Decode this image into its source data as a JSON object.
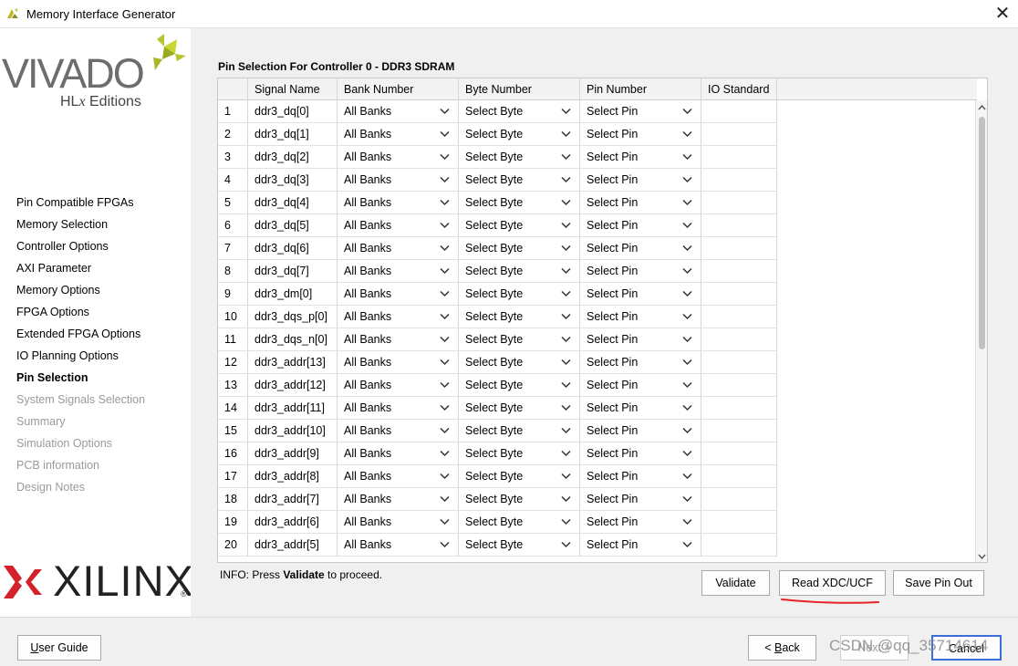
{
  "window": {
    "title": "Memory Interface Generator",
    "close_glyph": "✕"
  },
  "branding": {
    "vivado": "VIVADO",
    "hlx_prefix": "HL",
    "hlx_italic": "x",
    "hlx_suffix": " Editions",
    "xilinx": "XILINX",
    "xilinx_reg": "®"
  },
  "sidebar": {
    "items": [
      {
        "label": "Pin Compatible FPGAs",
        "state": "normal"
      },
      {
        "label": "Memory Selection",
        "state": "normal"
      },
      {
        "label": "Controller Options",
        "state": "normal"
      },
      {
        "label": "AXI Parameter",
        "state": "normal"
      },
      {
        "label": "Memory Options",
        "state": "normal"
      },
      {
        "label": "FPGA Options",
        "state": "normal"
      },
      {
        "label": "Extended FPGA Options",
        "state": "normal"
      },
      {
        "label": "IO Planning Options",
        "state": "normal"
      },
      {
        "label": "Pin Selection",
        "state": "active"
      },
      {
        "label": "System Signals Selection",
        "state": "disabled"
      },
      {
        "label": "Summary",
        "state": "disabled"
      },
      {
        "label": "Simulation Options",
        "state": "disabled"
      },
      {
        "label": "PCB information",
        "state": "disabled"
      },
      {
        "label": "Design Notes",
        "state": "disabled"
      }
    ]
  },
  "main": {
    "title": "Pin Selection For Controller 0 - DDR3 SDRAM",
    "columns": [
      "",
      "Signal Name",
      "Bank Number",
      "Byte Number",
      "Pin Number",
      "IO Standard"
    ],
    "rows": [
      {
        "num": "1",
        "signal": "ddr3_dq[0]",
        "bank": "All Banks",
        "byte": "Select Byte",
        "pin": "Select Pin",
        "io": ""
      },
      {
        "num": "2",
        "signal": "ddr3_dq[1]",
        "bank": "All Banks",
        "byte": "Select Byte",
        "pin": "Select Pin",
        "io": ""
      },
      {
        "num": "3",
        "signal": "ddr3_dq[2]",
        "bank": "All Banks",
        "byte": "Select Byte",
        "pin": "Select Pin",
        "io": ""
      },
      {
        "num": "4",
        "signal": "ddr3_dq[3]",
        "bank": "All Banks",
        "byte": "Select Byte",
        "pin": "Select Pin",
        "io": ""
      },
      {
        "num": "5",
        "signal": "ddr3_dq[4]",
        "bank": "All Banks",
        "byte": "Select Byte",
        "pin": "Select Pin",
        "io": ""
      },
      {
        "num": "6",
        "signal": "ddr3_dq[5]",
        "bank": "All Banks",
        "byte": "Select Byte",
        "pin": "Select Pin",
        "io": ""
      },
      {
        "num": "7",
        "signal": "ddr3_dq[6]",
        "bank": "All Banks",
        "byte": "Select Byte",
        "pin": "Select Pin",
        "io": ""
      },
      {
        "num": "8",
        "signal": "ddr3_dq[7]",
        "bank": "All Banks",
        "byte": "Select Byte",
        "pin": "Select Pin",
        "io": ""
      },
      {
        "num": "9",
        "signal": "ddr3_dm[0]",
        "bank": "All Banks",
        "byte": "Select Byte",
        "pin": "Select Pin",
        "io": ""
      },
      {
        "num": "10",
        "signal": "ddr3_dqs_p[0]",
        "bank": "All Banks",
        "byte": "Select Byte",
        "pin": "Select Pin",
        "io": ""
      },
      {
        "num": "11",
        "signal": "ddr3_dqs_n[0]",
        "bank": "All Banks",
        "byte": "Select Byte",
        "pin": "Select Pin",
        "io": ""
      },
      {
        "num": "12",
        "signal": "ddr3_addr[13]",
        "bank": "All Banks",
        "byte": "Select Byte",
        "pin": "Select Pin",
        "io": ""
      },
      {
        "num": "13",
        "signal": "ddr3_addr[12]",
        "bank": "All Banks",
        "byte": "Select Byte",
        "pin": "Select Pin",
        "io": ""
      },
      {
        "num": "14",
        "signal": "ddr3_addr[11]",
        "bank": "All Banks",
        "byte": "Select Byte",
        "pin": "Select Pin",
        "io": ""
      },
      {
        "num": "15",
        "signal": "ddr3_addr[10]",
        "bank": "All Banks",
        "byte": "Select Byte",
        "pin": "Select Pin",
        "io": ""
      },
      {
        "num": "16",
        "signal": "ddr3_addr[9]",
        "bank": "All Banks",
        "byte": "Select Byte",
        "pin": "Select Pin",
        "io": ""
      },
      {
        "num": "17",
        "signal": "ddr3_addr[8]",
        "bank": "All Banks",
        "byte": "Select Byte",
        "pin": "Select Pin",
        "io": ""
      },
      {
        "num": "18",
        "signal": "ddr3_addr[7]",
        "bank": "All Banks",
        "byte": "Select Byte",
        "pin": "Select Pin",
        "io": ""
      },
      {
        "num": "19",
        "signal": "ddr3_addr[6]",
        "bank": "All Banks",
        "byte": "Select Byte",
        "pin": "Select Pin",
        "io": ""
      },
      {
        "num": "20",
        "signal": "ddr3_addr[5]",
        "bank": "All Banks",
        "byte": "Select Byte",
        "pin": "Select Pin",
        "io": ""
      }
    ],
    "info_prefix": "INFO: Press ",
    "info_bold": "Validate",
    "info_suffix": " to proceed.",
    "buttons": {
      "validate": "Validate",
      "read_xdc": "Read XDC/UCF",
      "save_pin_out": "Save Pin Out"
    }
  },
  "footer": {
    "user_guide_u": "U",
    "user_guide_rest": "ser Guide",
    "back_prefix": "< ",
    "back_u": "B",
    "back_rest": "ack",
    "next": "Next >",
    "cancel": "Cancel",
    "watermark": "CSDN @qq_35714614"
  },
  "colors": {
    "annotation_red": "#e8212b",
    "xilinx_red": "#d3222a",
    "vivado_leaf_green": "#b5c52b",
    "focus_blue": "#3a6fd8"
  }
}
